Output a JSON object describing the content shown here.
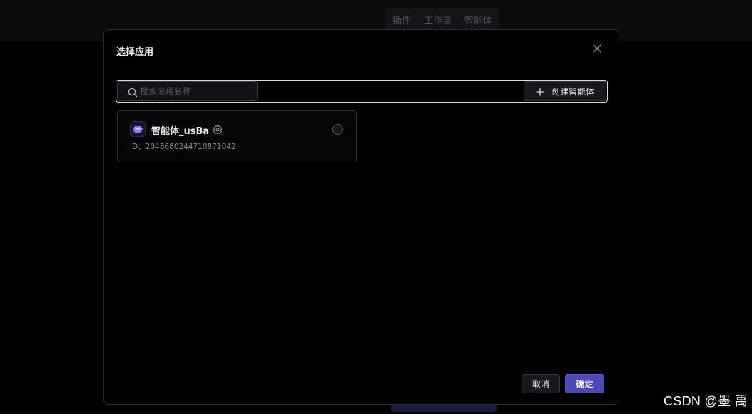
{
  "background": {
    "tabs": [
      "插件",
      "工作流",
      "智能体"
    ]
  },
  "modal": {
    "title": "选择应用",
    "close_icon": "close-icon",
    "search": {
      "placeholder": "搜索应用名称",
      "value": "",
      "icon": "search-icon"
    },
    "create_button": {
      "label": "创建智能体",
      "icon": "plus-icon"
    },
    "apps": [
      {
        "name": "智能体_usBa",
        "id_label": "ID：",
        "id_value": "2048680244710871042",
        "avatar_icon": "bot-avatar-icon",
        "settings_icon": "gear-icon",
        "selected": false
      }
    ],
    "footer": {
      "cancel_label": "取消",
      "confirm_label": "确定"
    }
  },
  "watermark": "CSDN @墨 禹",
  "colors": {
    "accent": "#4c49b6",
    "background": "#000000",
    "border": "#33333b"
  }
}
